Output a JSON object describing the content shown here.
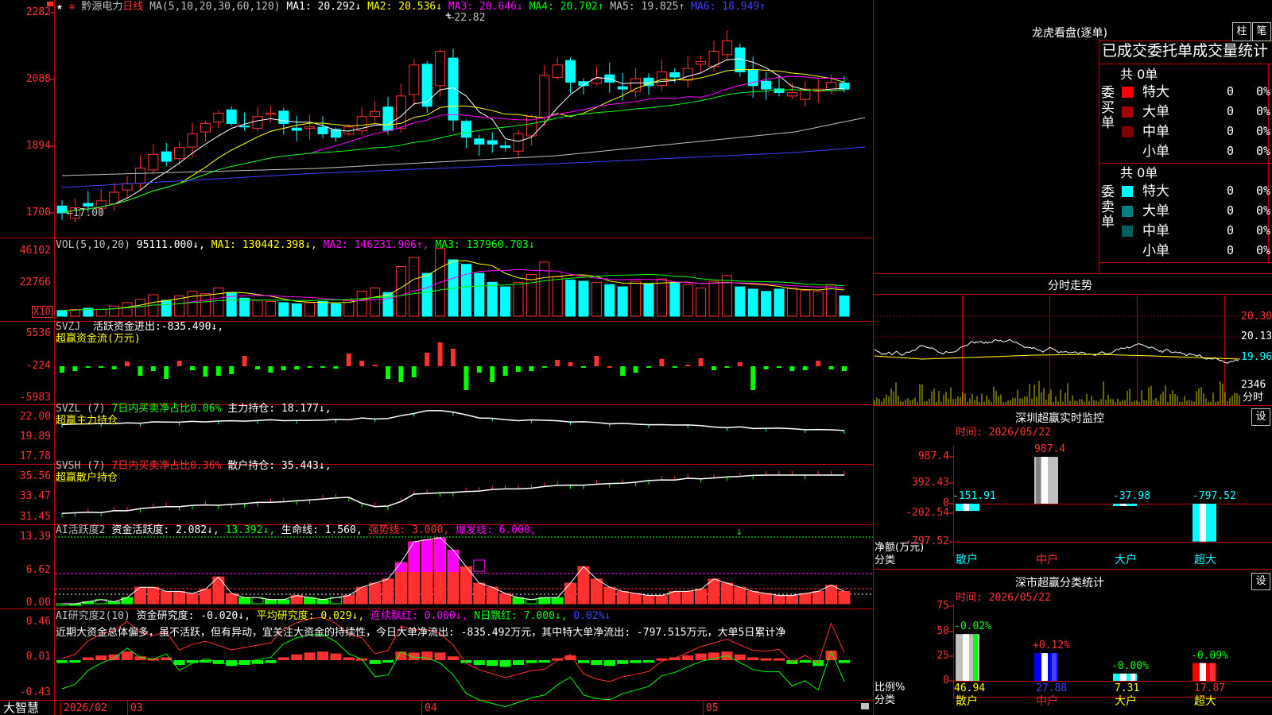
{
  "app": {
    "brand": "大智慧"
  },
  "header": {
    "stock": "黔源电力",
    "period": "日线",
    "ma_label": "MA(5,10,20,30,60,120)",
    "ma": [
      {
        "label": "MA1:",
        "value": "20.292",
        "arrow": "↓",
        "color": "#ffffff"
      },
      {
        "label": "MA2:",
        "value": "20.536",
        "arrow": "↓",
        "color": "#ffff00"
      },
      {
        "label": "MA3:",
        "value": "20.646",
        "arrow": "↓",
        "color": "#ff00ff"
      },
      {
        "label": "MA4:",
        "value": "20.702",
        "arrow": "↑",
        "color": "#00ff00"
      },
      {
        "label": "MA5:",
        "value": "19.825",
        "arrow": "↑",
        "color": "#c0c0c0"
      },
      {
        "label": "MA6:",
        "value": "18.949",
        "arrow": "↑",
        "color": "#4040ff"
      }
    ],
    "high_mark": "22.82",
    "low_mark": "17.00"
  },
  "price_axis": [
    "2282",
    "2088",
    "1894",
    "1700"
  ],
  "vol": {
    "label": "VOL(5,10,20)",
    "value": "95111.000",
    "ma1": "MA1: 130442.398",
    "ma2": "MA2: 146231.906",
    "ma3": "MA3: 137960.703",
    "axis": [
      "46102",
      "22766"
    ],
    "unit": "X10"
  },
  "svzj": {
    "label": "SVZJ",
    "title": "活跃资金进出:",
    "value": "-835.490",
    "sub": "超赢资金流(万元)",
    "axis": [
      "5536",
      "-224",
      "-5983"
    ]
  },
  "svzl": {
    "label": "SVZL (7)",
    "desc": "7日内买卖净占比0.06%",
    "title": "主力持仓:",
    "value": "18.177",
    "sub": "超赢主力持仓",
    "axis": [
      "22.00",
      "19.89",
      "17.78"
    ]
  },
  "svsh": {
    "label": "SVSH (7)",
    "desc": "7日内买卖净占比0.36%",
    "title": "散户持仓:",
    "value": "35.443",
    "sub": "超赢散户持仓",
    "axis": [
      "35.56",
      "33.47",
      "31.45"
    ]
  },
  "ai1": {
    "label": "AI活跃度2",
    "title": "资金活跃度:",
    "v1": "2.082",
    "v2": "13.392",
    "line": "生命线: 1.560,",
    "strong": "强势线: 3.000,",
    "burst": "爆发线: 6.000,",
    "axis": [
      "13.39",
      "6.62",
      "0.00"
    ]
  },
  "ai2": {
    "label": "AI研究度2(10)",
    "title": "资金研究度:",
    "v1": "-0.020",
    "avg": "平均研究度: 0.029",
    "lianxu": "连续飘红: 0.000",
    "nday": "N日飘红: 7.000",
    "pct": "0.02%",
    "axis": [
      "0.46",
      "0.01",
      "-0.43"
    ],
    "comment": "近期大资金总体偏多，虽不活跃，但有异动，宜关注大资金的持续性，今日大单净流出: -835.492万元，其中特大单净流出: -797.515万元，大单5日累计净"
  },
  "dates": [
    "2026/02",
    "03",
    "04",
    "05"
  ],
  "right": {
    "lhb_title": "龙虎看盘(逐单)",
    "btn1": "柱",
    "btn2": "笔",
    "tab_title": "已成交委托单成交量统计",
    "buy": {
      "label": "委买单",
      "total": "共 0单",
      "rows": [
        {
          "name": "特大",
          "value": "0",
          "pct": "0%"
        },
        {
          "name": "大单",
          "value": "0",
          "pct": "0%"
        },
        {
          "name": "中单",
          "value": "0",
          "pct": "0%"
        },
        {
          "name": "小单",
          "value": "0",
          "pct": "0%"
        }
      ]
    },
    "sell": {
      "label": "委卖单",
      "total": "共 0单",
      "rows": [
        {
          "name": "特大",
          "value": "0",
          "pct": "0%"
        },
        {
          "name": "大单",
          "value": "0",
          "pct": "0%"
        },
        {
          "name": "中单",
          "value": "0",
          "pct": "0%"
        },
        {
          "name": "小单",
          "value": "0",
          "pct": "0%"
        }
      ]
    },
    "fenshi": {
      "title": "分时走势",
      "p1": "20.30",
      "p2": "20.13",
      "p3": "19.96",
      "vol": "2346",
      "vol_label": "分时"
    },
    "monitor": {
      "title": "深圳超赢实时监控",
      "set": "设",
      "time": "时间: 2026/05/22",
      "yaxis": [
        "987.4",
        "392.43",
        "0",
        "-202.54",
        "-797.52"
      ],
      "net_label": "净额(万元)",
      "class_label": "分类"
    },
    "stats": {
      "title": "深市超赢分类统计",
      "set": "设",
      "time": "时间: 2026/05/22",
      "yaxis": [
        "75",
        "50",
        "25",
        "0"
      ],
      "ratio_label": "比例%",
      "class_label": "分类"
    }
  },
  "chart_data": [
    {
      "type": "bar",
      "title": "深圳超赢实时监控",
      "categories": [
        "散户",
        "中户",
        "大户",
        "超大"
      ],
      "values": [
        -151.91,
        987.4,
        -37.98,
        -797.52
      ],
      "ylabel": "净额(万元)",
      "ylim": [
        -797.52,
        987.4
      ]
    },
    {
      "type": "bar",
      "title": "深市超赢分类统计",
      "categories": [
        "散户",
        "中户",
        "大户",
        "超大"
      ],
      "values": [
        46.94,
        27.88,
        7.31,
        17.87
      ],
      "change": [
        "-0.02%",
        "+0.12%",
        "-0.00%",
        "-0.09%"
      ],
      "ylabel": "比例%",
      "ylim": [
        0,
        75
      ]
    }
  ]
}
